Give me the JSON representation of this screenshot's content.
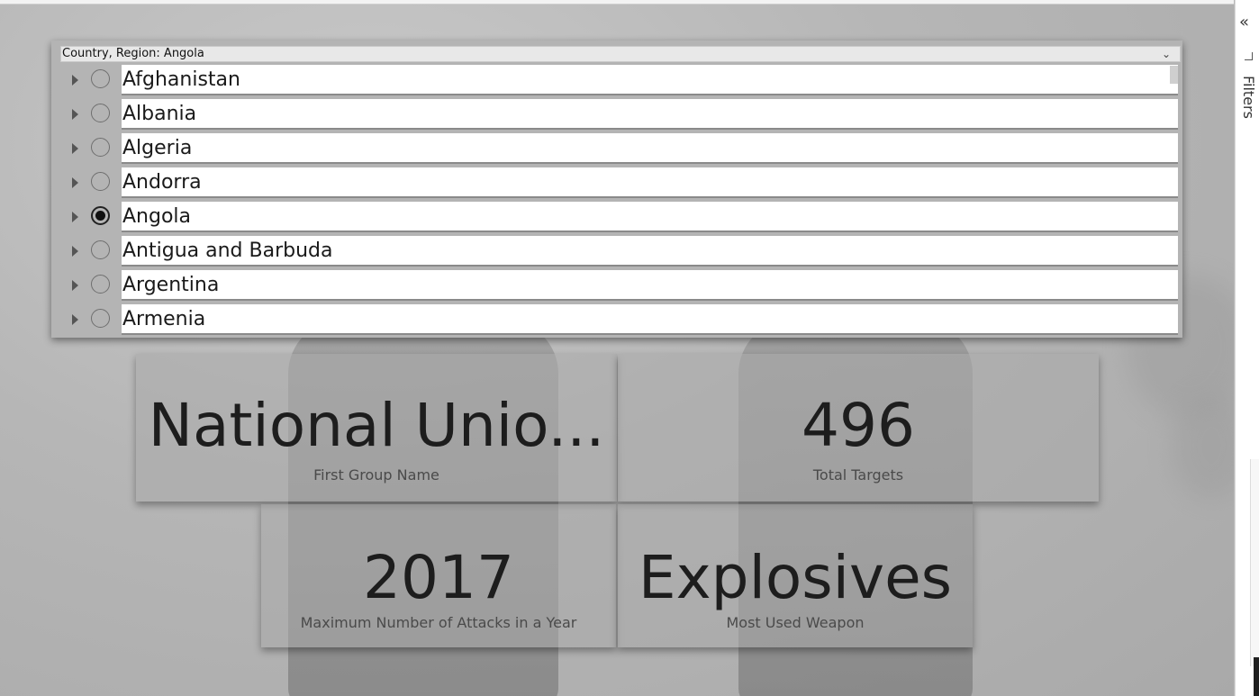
{
  "slicer": {
    "header": "Country, Region: Angola",
    "items": [
      {
        "label": "Afghanistan",
        "selected": false
      },
      {
        "label": "Albania",
        "selected": false
      },
      {
        "label": "Algeria",
        "selected": false
      },
      {
        "label": "Andorra",
        "selected": false
      },
      {
        "label": "Angola",
        "selected": true
      },
      {
        "label": "Antigua and Barbuda",
        "selected": false
      },
      {
        "label": "Argentina",
        "selected": false
      },
      {
        "label": "Armenia",
        "selected": false
      }
    ]
  },
  "cards": {
    "group": {
      "value": "National Unio...",
      "caption": "First Group Name"
    },
    "targets": {
      "value": "496",
      "caption": "Total Targets"
    },
    "year": {
      "value": "2017",
      "caption": "Maximum Number of Attacks in a Year"
    },
    "weapon": {
      "value": "Explosives",
      "caption": "Most Used Weapon"
    }
  },
  "filters_pane": {
    "label": "Filters",
    "collapse_icon": "double-chevron-left-icon"
  }
}
